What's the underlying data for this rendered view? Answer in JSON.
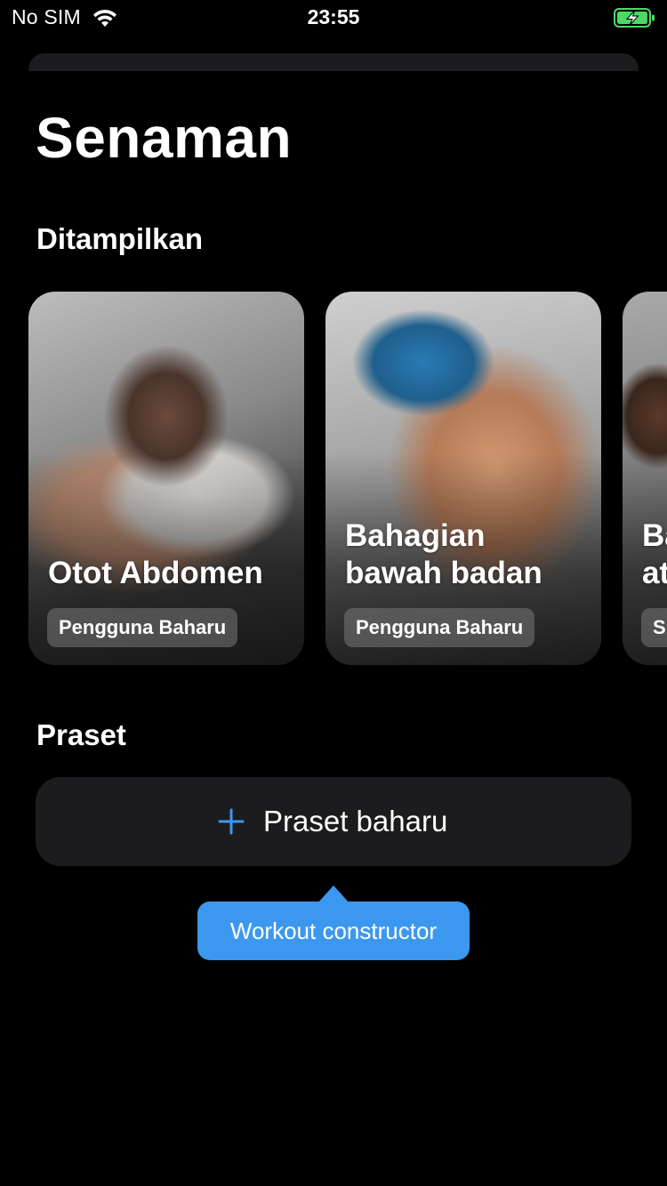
{
  "status_bar": {
    "carrier": "No SIM",
    "time": "23:55",
    "wifi_icon": "wifi-icon",
    "battery_icon": "battery-charging-icon",
    "battery_color": "#4cd964"
  },
  "page": {
    "title": "Senaman"
  },
  "featured": {
    "heading": "Ditampilkan",
    "cards": [
      {
        "title": "Otot Abdomen",
        "badge": "Pengguna Baharu"
      },
      {
        "title": "Bahagian\nbawah badan",
        "badge": "Pengguna Baharu"
      },
      {
        "title": "Ba\nat",
        "badge": "S"
      }
    ]
  },
  "presets": {
    "heading": "Praset",
    "new_button_label": "Praset baharu",
    "new_button_icon": "plus-icon",
    "accent_color": "#3c98ee"
  },
  "tooltip": {
    "text": "Workout constructor",
    "color": "#3c98ee"
  }
}
